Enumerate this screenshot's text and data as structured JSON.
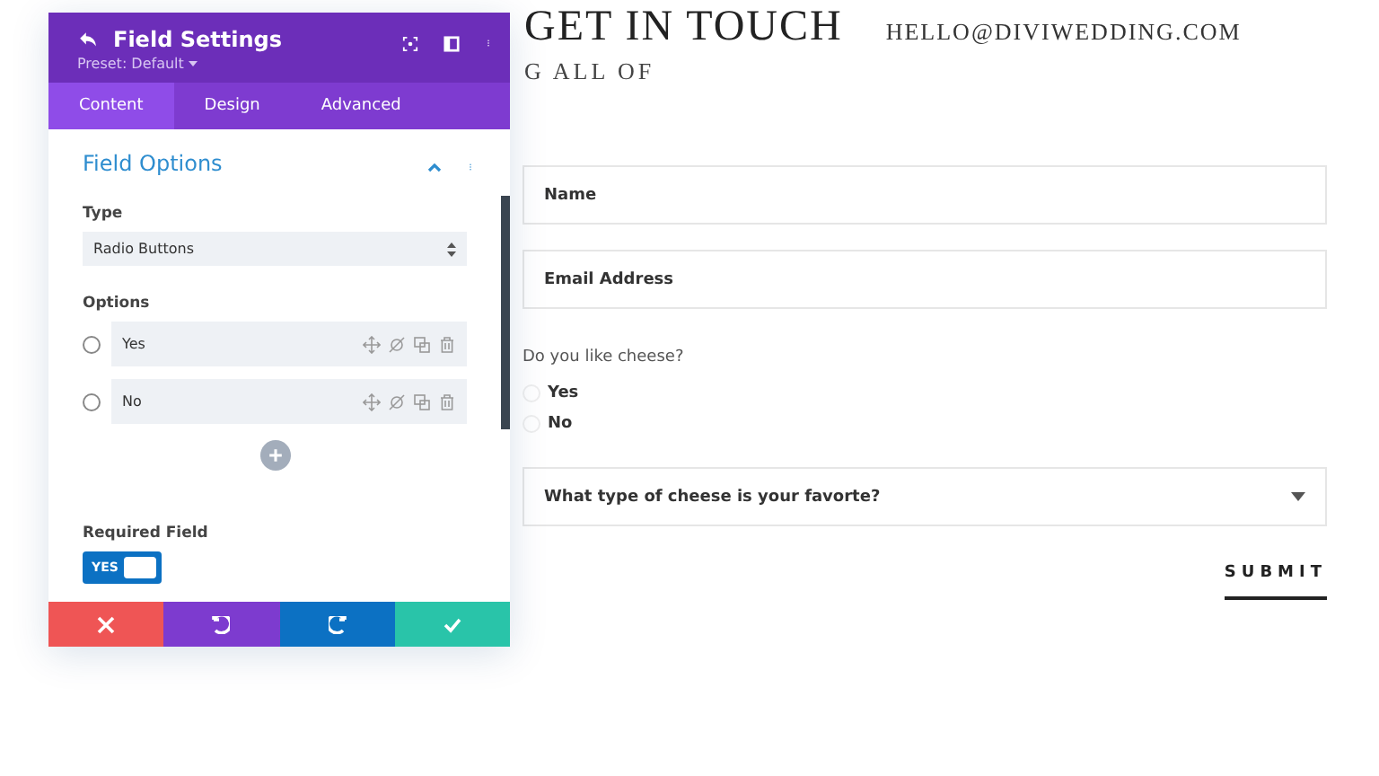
{
  "header": {
    "title": "GET IN TOUCH",
    "email": "HELLO@DIVIWEDDING.COM",
    "subtitle": "G ALL OF"
  },
  "panel": {
    "title": "Field Settings",
    "preset": "Preset: Default",
    "tabs": [
      {
        "label": "Content",
        "selected": true
      },
      {
        "label": "Design",
        "selected": false
      },
      {
        "label": "Advanced",
        "selected": false
      }
    ],
    "section": {
      "title": "Field Options",
      "expanded": true
    },
    "type": {
      "label": "Type",
      "value": "Radio Buttons"
    },
    "options": {
      "label": "Options",
      "items": [
        {
          "label": "Yes",
          "selected": false
        },
        {
          "label": "No",
          "selected": false
        }
      ]
    },
    "required": {
      "label": "Required Field",
      "toggle_text": "YES",
      "on": true
    },
    "actions": [
      {
        "kind": "cancel"
      },
      {
        "kind": "undo"
      },
      {
        "kind": "redo"
      },
      {
        "kind": "save"
      }
    ]
  },
  "form": {
    "fields": [
      {
        "kind": "text",
        "placeholder": "Name"
      },
      {
        "kind": "text",
        "placeholder": "Email Address"
      },
      {
        "kind": "radio",
        "question": "Do you like cheese?",
        "options": [
          {
            "label": "Yes",
            "selected": false
          },
          {
            "label": "No",
            "selected": false
          }
        ]
      },
      {
        "kind": "select",
        "value": "What type of cheese is your favorte?"
      }
    ],
    "submit": "SUBMIT"
  }
}
